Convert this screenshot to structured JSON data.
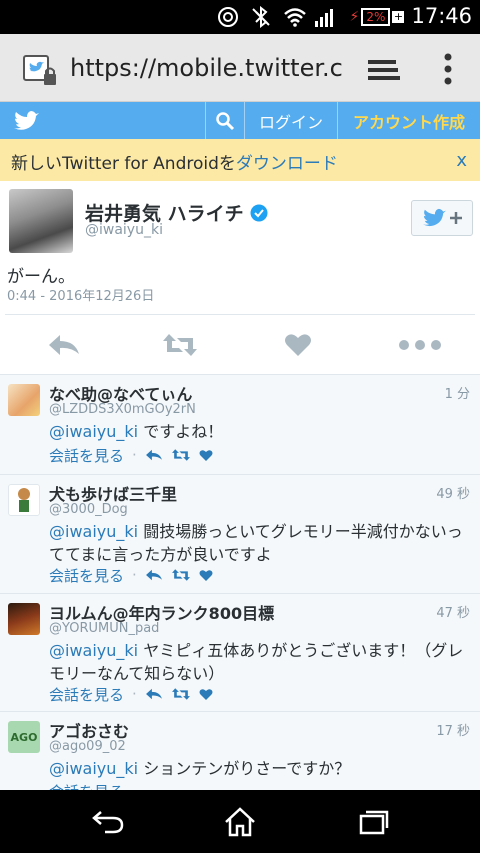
{
  "status_bar": {
    "battery": "2%",
    "time": "17:46"
  },
  "browser": {
    "url": "https://mobile.twitter.com"
  },
  "twitter_header": {
    "login": "ログイン",
    "signup": "アカウント作成"
  },
  "promo": {
    "text_prefix": "新しいTwitter for Androidを",
    "link": "ダウンロード",
    "close": "x"
  },
  "tweet": {
    "name": "岩井勇気 ハライチ",
    "handle": "@iwaiyu_ki",
    "text": "がーん。",
    "time": "0:44 - 2016年12月26日"
  },
  "replies": [
    {
      "name": "なべ助@なべてぃん",
      "handle": "@LZDDS3X0mGOy2rN",
      "time": "1 分",
      "mention": "@iwaiyu_ki",
      "text": " ですよね！",
      "view": "会話を見る",
      "avatar_color": "#f2d9b8"
    },
    {
      "name": "犬も歩けば三千里",
      "handle": "@3000_Dog",
      "time": "49 秒",
      "mention": "@iwaiyu_ki",
      "text": " 闘技場勝っといてグレモリー半減付かないっててまに言った方が良いですよ",
      "view": "会話を見る",
      "avatar_color": "#e8d4a8"
    },
    {
      "name": "ヨルムん@年内ランク800目標",
      "handle": "@YORUMUN_pad",
      "time": "47 秒",
      "mention": "@iwaiyu_ki",
      "text": " ヤミピィ五体ありがとうございます！（グレモリーなんて知らない）",
      "view": "会話を見る",
      "avatar_color": "#8a3a1a"
    },
    {
      "name": "アゴおさむ",
      "handle": "@ago09_02",
      "time": "17 秒",
      "mention": "@iwaiyu_ki",
      "text": " ションテンがりさーですか？",
      "view": "会話を見る",
      "avatar_color": "#9ad0a0",
      "avatar_text": "AGO"
    }
  ],
  "colors": {
    "twitter_blue": "#55acee",
    "link_blue": "#2b7bb9",
    "promo_bg": "#fde9a6",
    "signup_text": "#ffd84d"
  }
}
